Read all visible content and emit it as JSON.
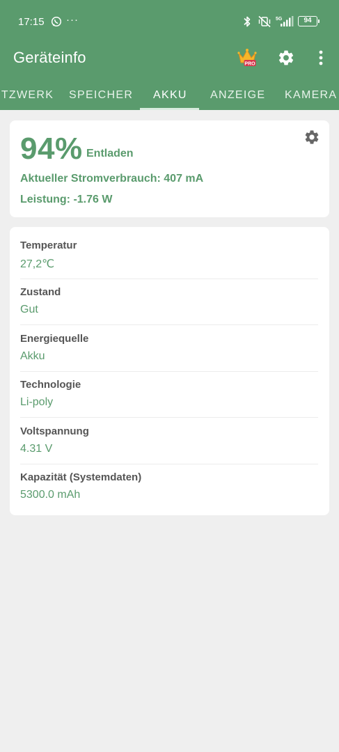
{
  "status_bar": {
    "time": "17:15",
    "dots": "···",
    "battery_level": "94"
  },
  "toolbar": {
    "title": "Geräteinfo",
    "pro_badge": "PRO"
  },
  "tabs": [
    {
      "label": "NETZWERK"
    },
    {
      "label": "SPEICHER"
    },
    {
      "label": "AKKU"
    },
    {
      "label": "ANZEIGE"
    },
    {
      "label": "KAMERA"
    }
  ],
  "active_tab": "AKKU",
  "battery_summary": {
    "percent": "94%",
    "status": "Entladen",
    "current": "Aktueller Stromverbrauch: 407 mA",
    "power": "Leistung: -1.76 W"
  },
  "details": [
    {
      "label": "Temperatur",
      "value": "27,2℃"
    },
    {
      "label": "Zustand",
      "value": "Gut"
    },
    {
      "label": "Energiequelle",
      "value": "Akku"
    },
    {
      "label": "Technologie",
      "value": "Li-poly"
    },
    {
      "label": "Voltspannung",
      "value": "4.31 V"
    },
    {
      "label": "Kapazität (Systemdaten)",
      "value": "5300.0 mAh"
    }
  ],
  "colors": {
    "primary": "#5a9b6d",
    "background": "#efefef",
    "card": "#ffffff",
    "label_text": "#555555"
  }
}
